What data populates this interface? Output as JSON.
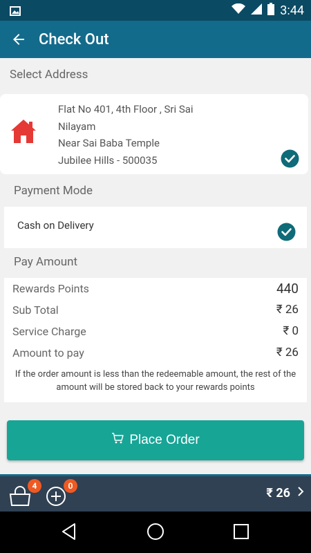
{
  "status_bar": {
    "time": "3:44"
  },
  "header": {
    "title": "Check Out"
  },
  "address_section": {
    "title": "Select Address",
    "lines": [
      "Flat No 401, 4th Floor , Sri Sai",
      "Nilayam",
      "Near Sai Baba Temple",
      "Jubilee Hills - 500035"
    ]
  },
  "payment_section": {
    "title": "Payment Mode",
    "selected": "Cash on Delivery"
  },
  "pay_section": {
    "title": "Pay Amount",
    "rows": [
      {
        "label": "Rewards Points",
        "value": "440"
      },
      {
        "label": "Sub Total",
        "value": "₹ 26"
      },
      {
        "label": "Service Charge",
        "value": "₹ 0"
      },
      {
        "label": "Amount to pay",
        "value": "₹ 26"
      }
    ],
    "note": "If the order amount is less than the redeemable amount, the rest of the amount will be stored back to your rewards points"
  },
  "place_order": {
    "label": "Place Order"
  },
  "bottom_bar": {
    "cart_count": "4",
    "add_count": "0",
    "total": "₹ 26"
  },
  "colors": {
    "header": "#136b8c",
    "status_bar": "#0b4a63",
    "accent": "#17a596",
    "home_icon": "#e53935",
    "badge": "#f05a22",
    "bottom_bar": "#304153"
  }
}
